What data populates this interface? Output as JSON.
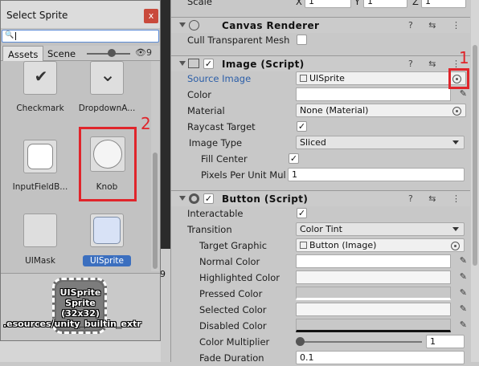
{
  "inspector": {
    "top_row": {
      "label": "Scale",
      "x_label": "X",
      "x": "1",
      "y_label": "Y",
      "y": "1",
      "z_label": "Z",
      "z": "1"
    },
    "canvas_renderer": {
      "title": "Canvas Renderer",
      "cull_label": "Cull Transparent Mesh"
    },
    "image": {
      "title": "Image (Script)",
      "source_image_label": "Source Image",
      "source_image_value": "UISprite",
      "color_label": "Color",
      "material_label": "Material",
      "material_value": "None (Material)",
      "raycast_label": "Raycast Target",
      "image_type_label": "Image Type",
      "image_type_value": "Sliced",
      "fill_center_label": "Fill Center",
      "ppu_label": "Pixels Per Unit Mul",
      "ppu_value": "1"
    },
    "button": {
      "title": "Button (Script)",
      "interactable_label": "Interactable",
      "transition_label": "Transition",
      "transition_value": "Color Tint",
      "target_graphic_label": "Target Graphic",
      "target_graphic_value": "Button (Image)",
      "normal_label": "Normal Color",
      "highlighted_label": "Highlighted Color",
      "pressed_label": "Pressed Color",
      "selected_label": "Selected Color",
      "disabled_label": "Disabled Color",
      "multiplier_label": "Color Multiplier",
      "multiplier_value": "1",
      "fade_label": "Fade Duration",
      "fade_value": "0.1"
    },
    "header_icons": "? ⇆ ⋮"
  },
  "sprite_window": {
    "title": "Select Sprite",
    "close": "x",
    "search_icon": "search-icon",
    "tabs": [
      "Assets",
      "Scene"
    ],
    "hidden_count": "9",
    "items": [
      {
        "label": "Checkmark",
        "icon": "checkmark-icon",
        "glyph": "✔"
      },
      {
        "label": "DropdownA...",
        "icon": "dropdown-arrow-icon",
        "glyph": "⌄"
      },
      {
        "label": "InputFieldB...",
        "icon": "input-field-background-icon"
      },
      {
        "label": "Knob",
        "icon": "knob-icon"
      },
      {
        "label": "UIMask",
        "icon": "ui-mask-icon"
      },
      {
        "label": "UISprite",
        "icon": "ui-sprite-icon",
        "selected": true
      }
    ],
    "preview": {
      "name": "UISprite",
      "kind": "Sprite",
      "size": "(32x32)",
      "path": ".esources/unity_builtin_extr"
    }
  },
  "strip_number": "9",
  "annotations": {
    "one": "1",
    "two": "2"
  },
  "colors": {
    "annotation_red": "#e0252b",
    "selection_blue": "#3b6fbf"
  }
}
